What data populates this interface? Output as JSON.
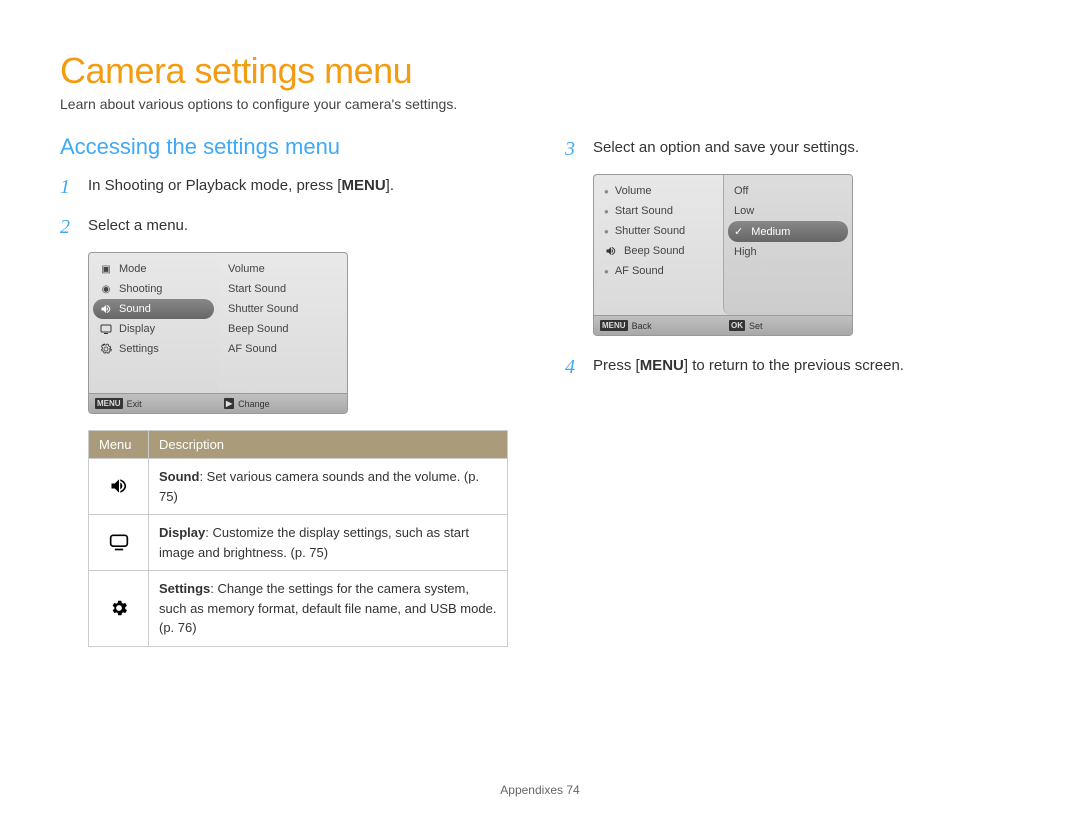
{
  "title": "Camera settings menu",
  "subtitle": "Learn about various options to configure your camera's settings.",
  "section_heading": "Accessing the settings menu",
  "steps": {
    "s1": {
      "num": "1",
      "pre": "In Shooting or Playback mode, press [",
      "key": "MENU",
      "post": "]."
    },
    "s2": {
      "num": "2",
      "text": "Select a menu."
    },
    "s3": {
      "num": "3",
      "text": "Select an option and save your settings."
    },
    "s4": {
      "num": "4",
      "pre": "Press [",
      "key": "MENU",
      "post": "] to return to the previous screen."
    }
  },
  "screen1": {
    "left": {
      "i0": "Mode",
      "i1": "Shooting",
      "i2": "Sound",
      "i3": "Display",
      "i4": "Settings"
    },
    "right": {
      "i0": "Volume",
      "i1": "Start Sound",
      "i2": "Shutter Sound",
      "i3": "Beep Sound",
      "i4": "AF Sound"
    },
    "footer_left_btn": "MENU",
    "footer_left": "Exit",
    "footer_right_btn": "▶",
    "footer_right": "Change"
  },
  "screen2": {
    "left": {
      "i0": "Volume",
      "i1": "Start Sound",
      "i2": "Shutter Sound",
      "i3": "Beep Sound",
      "i4": "AF Sound"
    },
    "right": {
      "i0": "Off",
      "i1": "Low",
      "i2": "Medium",
      "i3": "High"
    },
    "footer_left_btn": "MENU",
    "footer_left": "Back",
    "footer_right_btn": "OK",
    "footer_right": "Set"
  },
  "table": {
    "h0": "Menu",
    "h1": "Description",
    "r0": {
      "title": "Sound",
      "body": ": Set various camera sounds and the volume. (p. 75)"
    },
    "r1": {
      "title": "Display",
      "body": ": Customize the display settings, such as start image and brightness. (p. 75)"
    },
    "r2": {
      "title": "Settings",
      "body": ": Change the settings for the camera system, such as memory format, default file name, and USB mode. (p. 76)"
    }
  },
  "footer": {
    "label": "Appendixes",
    "page": "74"
  }
}
